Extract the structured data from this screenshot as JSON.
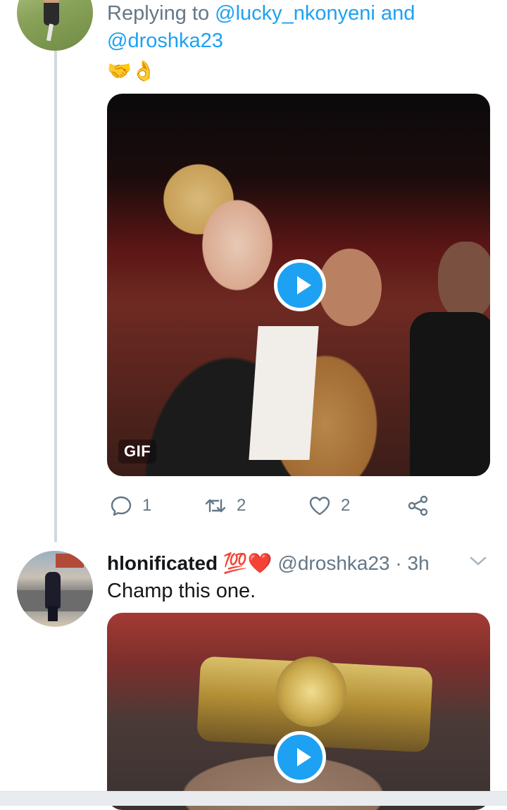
{
  "tweet1": {
    "reply_prefix": "Replying to",
    "mention1": "@lucky_nkonyeni",
    "joiner": "and",
    "mention2": "@droshka23",
    "emojis": "🤝👌",
    "media_badge": "GIF",
    "actions": {
      "reply_count": "1",
      "retweet_count": "2",
      "like_count": "2"
    }
  },
  "tweet2": {
    "display_name": "hlonificated",
    "name_emojis": "💯❤️",
    "handle": "@droshka23",
    "separator": "·",
    "time": "3h",
    "text": "Champ this one."
  },
  "icons": {
    "reply": "reply-icon",
    "retweet": "retweet-icon",
    "like": "heart-icon",
    "share": "share-icon",
    "play": "play-icon",
    "menu": "chevron-down-icon"
  },
  "colors": {
    "accent": "#1da1f2",
    "secondary_text": "#657786",
    "primary_text": "#14171a",
    "thread_line": "#cfd9de"
  }
}
